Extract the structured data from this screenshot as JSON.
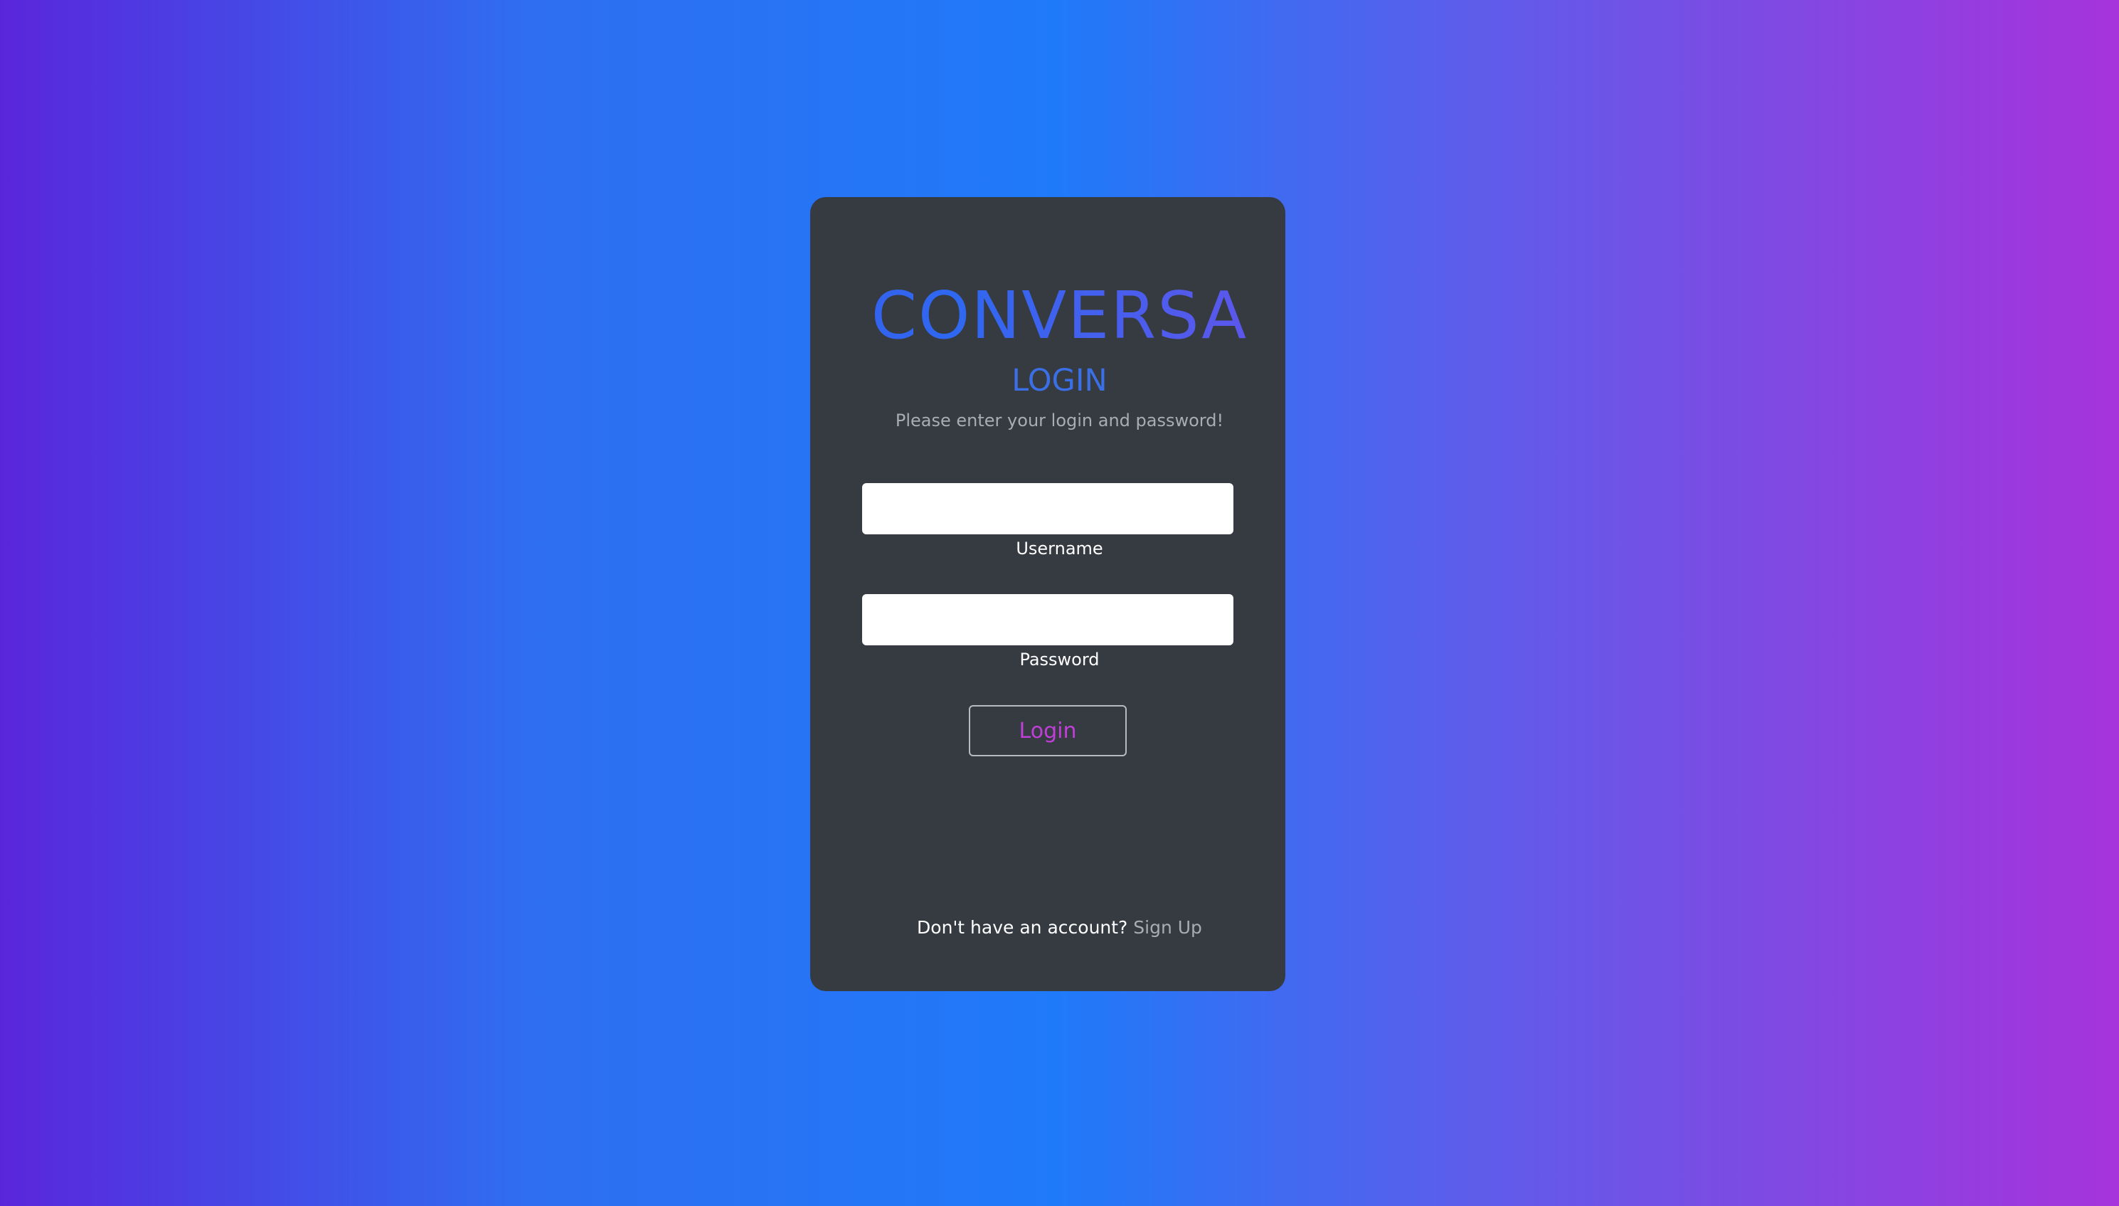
{
  "colors": {
    "background_gradient": [
      "#5a26db",
      "#2f6ef1",
      "#1f7af9",
      "#5f5cea",
      "#a633db"
    ],
    "card_background": "#363a41",
    "brand_gradient": [
      "#5b2ee0",
      "#2f68f0",
      "#7f49e8",
      "#b334d7"
    ],
    "title_color": "#3b6fe6",
    "subtitle_color": "#a9adb3",
    "login_button_text": "#c03fd8",
    "link_color": "#a9adb3"
  },
  "brand": {
    "name": "CONVERSA"
  },
  "form": {
    "title": "LOGIN",
    "subtitle": "Please enter your login and password!",
    "username": {
      "label": "Username",
      "value": "",
      "placeholder": ""
    },
    "password": {
      "label": "Password",
      "value": "",
      "placeholder": ""
    },
    "submit_label": "Login"
  },
  "footer": {
    "prompt": "Don't have an account?",
    "link_label": "Sign Up"
  }
}
